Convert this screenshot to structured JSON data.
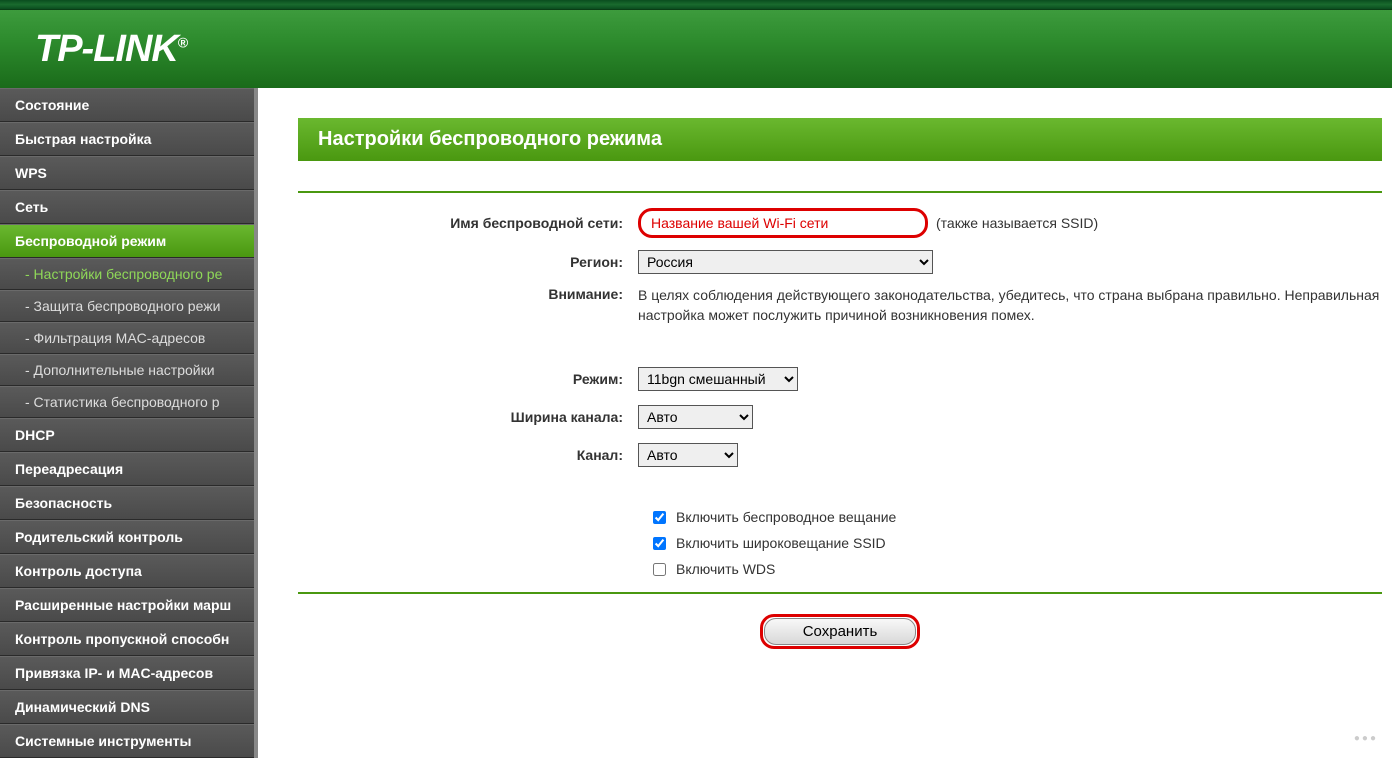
{
  "brand": "TP-LINK",
  "sidebar": {
    "items": [
      {
        "label": "Состояние",
        "type": "item"
      },
      {
        "label": "Быстрая настройка",
        "type": "item"
      },
      {
        "label": "WPS",
        "type": "item"
      },
      {
        "label": "Сеть",
        "type": "item"
      },
      {
        "label": "Беспроводной режим",
        "type": "item",
        "active": true
      },
      {
        "label": "- Настройки беспроводного ре",
        "type": "sub",
        "current": true
      },
      {
        "label": "- Защита беспроводного режи",
        "type": "sub"
      },
      {
        "label": "- Фильтрация MAC-адресов",
        "type": "sub"
      },
      {
        "label": "- Дополнительные настройки",
        "type": "sub"
      },
      {
        "label": "- Статистика беспроводного р",
        "type": "sub"
      },
      {
        "label": "DHCP",
        "type": "item"
      },
      {
        "label": "Переадресация",
        "type": "item"
      },
      {
        "label": "Безопасность",
        "type": "item"
      },
      {
        "label": "Родительский контроль",
        "type": "item"
      },
      {
        "label": "Контроль доступа",
        "type": "item"
      },
      {
        "label": "Расширенные настройки марш",
        "type": "item"
      },
      {
        "label": "Контроль пропускной способн",
        "type": "item"
      },
      {
        "label": "Привязка IP- и MAC-адресов",
        "type": "item"
      },
      {
        "label": "Динамический DNS",
        "type": "item"
      },
      {
        "label": "Системные инструменты",
        "type": "item"
      }
    ]
  },
  "page": {
    "title": "Настройки беспроводного режима",
    "labels": {
      "ssid": "Имя беспроводной сети:",
      "region": "Регион:",
      "warning": "Внимание:",
      "mode": "Режим:",
      "channel_width": "Ширина канала:",
      "channel": "Канал:"
    },
    "fields": {
      "ssid_value": "Название вашей Wi-Fi сети",
      "ssid_note": "(также называется SSID)",
      "region_value": "Россия",
      "warning_text": "В целях соблюдения действующего законодательства, убедитесь, что страна выбрана правильно. Неправильная настройка может послужить причиной возникновения помех.",
      "mode_value": "11bgn смешанный",
      "channel_width_value": "Авто",
      "channel_value": "Авто"
    },
    "checkboxes": {
      "broadcast": {
        "label": "Включить беспроводное вещание",
        "checked": true
      },
      "ssid_broadcast": {
        "label": "Включить широковещание SSID",
        "checked": true
      },
      "wds": {
        "label": "Включить WDS",
        "checked": false
      }
    },
    "save_button": "Сохранить"
  }
}
